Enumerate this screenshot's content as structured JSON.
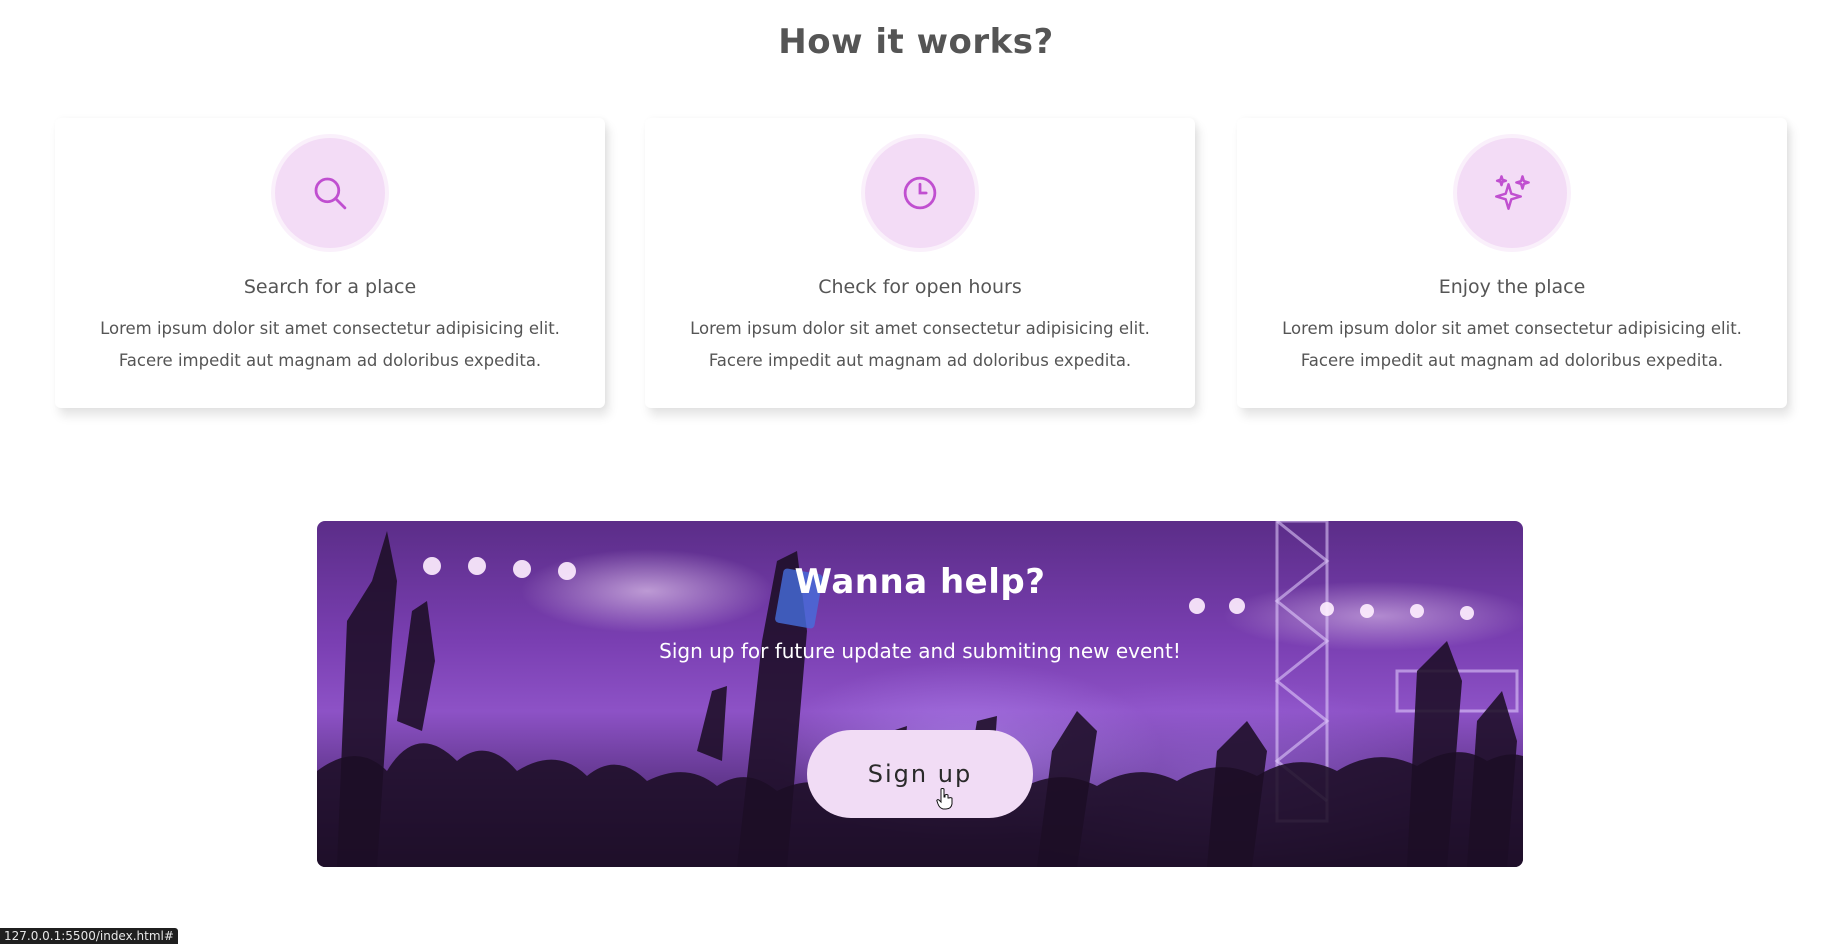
{
  "section": {
    "title": "How it works?"
  },
  "steps": [
    {
      "icon": "search-icon",
      "title": "Search for a place",
      "text_line1": "Lorem ipsum dolor sit amet consectetur adipisicing elit.",
      "text_line2": "Facere impedit aut magnam ad doloribus expedita."
    },
    {
      "icon": "clock-icon",
      "title": "Check for open hours",
      "text_line1": "Lorem ipsum dolor sit amet consectetur adipisicing elit.",
      "text_line2": "Facere impedit aut magnam ad doloribus expedita."
    },
    {
      "icon": "sparkles-icon",
      "title": "Enjoy the place",
      "text_line1": "Lorem ipsum dolor sit amet consectetur adipisicing elit.",
      "text_line2": "Facere impedit aut magnam ad doloribus expedita."
    }
  ],
  "banner": {
    "title": "Wanna help?",
    "subtitle": "Sign up for future update and submiting new event!",
    "button_label": "Sign up"
  },
  "status_bar": {
    "url": "127.0.0.1:5500/index.html#"
  },
  "colors": {
    "accent": "#c04fd0",
    "icon_bg": "#f3dcf6",
    "button_bg": "#f1dcf5",
    "banner_purple": "#7a3fb2"
  }
}
